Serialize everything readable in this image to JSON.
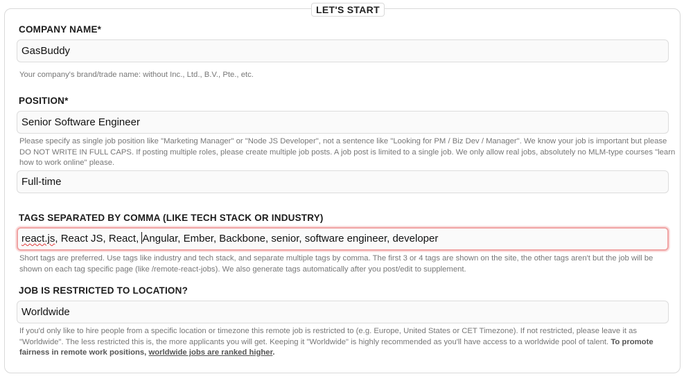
{
  "section_title": "LET'S START",
  "company": {
    "label": "COMPANY NAME*",
    "value": "GasBuddy",
    "help": "Your company's brand/trade name: without Inc., Ltd., B.V., Pte., etc."
  },
  "position": {
    "label": "POSITION*",
    "value": "Senior Software Engineer",
    "help": "Please specify as single job position like \"Marketing Manager\" or \"Node JS Developer\", not a sentence like \"Looking for PM / Biz Dev / Manager\". We know your job is important but please DO NOT WRITE IN FULL CAPS. If posting multiple roles, please create multiple job posts. A job post is limited to a single job. We only allow real jobs, absolutely no MLM-type courses \"learn how to work online\" please."
  },
  "employment_type": {
    "value": "Full-time"
  },
  "tags": {
    "label": "TAGS SEPARATED BY COMMA (LIKE TECH STACK OR INDUSTRY)",
    "value_misspelled": "react.js",
    "value_before_caret": ", React JS, React, ",
    "value_after_caret": "Angular, Ember, Backbone, senior, software engineer, developer",
    "help": "Short tags are preferred. Use tags like industry and tech stack, and separate multiple tags by comma. The first 3 or 4 tags are shown on the site, the other tags aren't but the job will be shown on each tag specific page (like /remote-react-jobs). We also generate tags automatically after you post/edit to supplement."
  },
  "location": {
    "label": "JOB IS RESTRICTED TO LOCATION?",
    "value": "Worldwide",
    "help": "If you'd only like to hire people from a specific location or timezone this remote job is restricted to (e.g. Europe, United States or CET Timezone). If not restricted, please leave it as \"Worldwide\". The less restricted this is, the more applicants you will get. Keeping it \"Worldwide\" is highly recommended as you'll have access to a worldwide pool of talent. ",
    "help_strong": "To promote fairness in remote work positions, ",
    "help_strong_underlined": "worldwide jobs are ranked higher",
    "help_end": "."
  }
}
